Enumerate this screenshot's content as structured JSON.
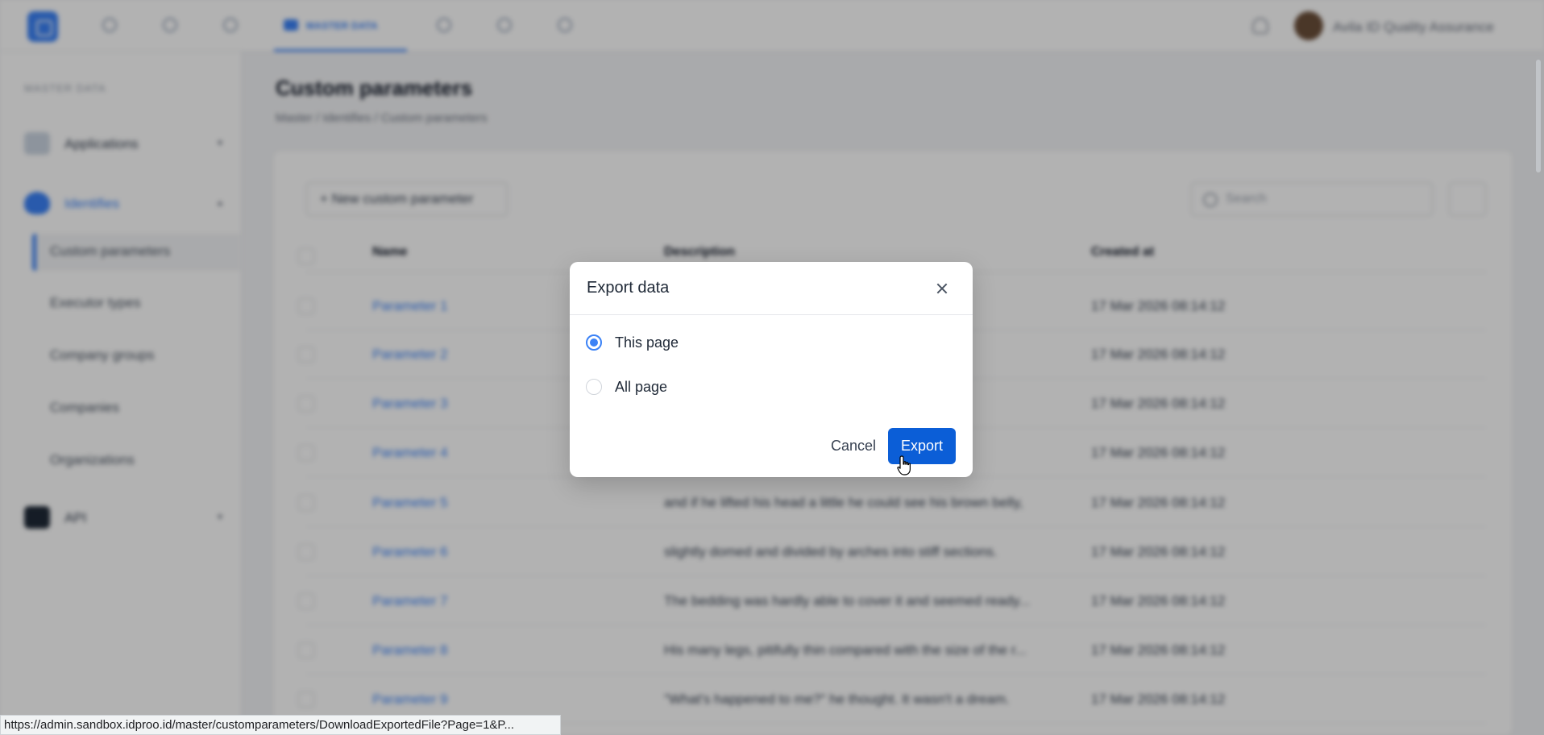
{
  "topbar": {
    "active_tab_label": "MASTER DATA",
    "user_name": "Avila ID Quality Assurance"
  },
  "sidebar": {
    "section_title": "MASTER DATA",
    "groups": [
      {
        "label": "Applications"
      },
      {
        "label": "Identifies"
      },
      {
        "label": "API"
      }
    ],
    "sub_items": [
      {
        "label": "Custom parameters"
      },
      {
        "label": "Executor types"
      },
      {
        "label": "Company groups"
      },
      {
        "label": "Companies"
      },
      {
        "label": "Organizations"
      }
    ]
  },
  "main": {
    "title": "Custom parameters",
    "breadcrumb": "Master  /  Identifies  /  Custom parameters",
    "new_button": "+ New custom parameter",
    "search_placeholder": "Search",
    "columns": {
      "name": "Name",
      "description": "Description",
      "created_at": "Created at"
    },
    "rows": [
      {
        "name": "Parameter 1",
        "description": "",
        "created_at": "17 Mar 2026 08:14:12"
      },
      {
        "name": "Parameter 2",
        "description": "",
        "created_at": "17 Mar 2026 08:14:12"
      },
      {
        "name": "Parameter 3",
        "description": "",
        "created_at": "17 Mar 2026 08:14:12"
      },
      {
        "name": "Parameter 4",
        "description": "",
        "created_at": "17 Mar 2026 08:14:12"
      },
      {
        "name": "Parameter 5",
        "description": "and if he lifted his head a little he could see his brown belly,",
        "created_at": "17 Mar 2026 08:14:12"
      },
      {
        "name": "Parameter 6",
        "description": "slightly domed and divided by arches into stiff sections.",
        "created_at": "17 Mar 2026 08:14:12"
      },
      {
        "name": "Parameter 7",
        "description": "The bedding was hardly able to cover it and seemed ready...",
        "created_at": "17 Mar 2026 08:14:12"
      },
      {
        "name": "Parameter 8",
        "description": "His many legs, pitifully thin compared with the size of the r...",
        "created_at": "17 Mar 2026 08:14:12"
      },
      {
        "name": "Parameter 9",
        "description": "\"What's happened to me?\" he thought. It wasn't a dream.",
        "created_at": "17 Mar 2026 08:14:12"
      }
    ]
  },
  "modal": {
    "title": "Export data",
    "options": [
      {
        "label": "This page",
        "checked": true
      },
      {
        "label": "All page",
        "checked": false
      }
    ],
    "cancel_label": "Cancel",
    "export_label": "Export"
  },
  "status_bar": {
    "url": "https://admin.sandbox.idproo.id/master/customparameters/DownloadExportedFile?Page=1&P..."
  },
  "colors": {
    "primary": "#0b5ed7",
    "accent": "#3b82f6",
    "overlay": "rgba(0,0,0,0.30)"
  }
}
